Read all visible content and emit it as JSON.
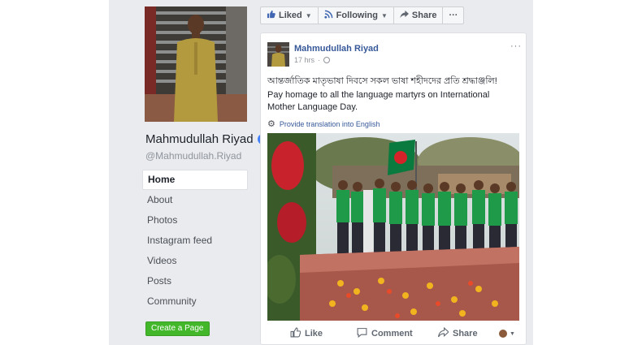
{
  "page": {
    "name": "Mahmudullah Riyad",
    "handle": "@Mahmudullah.Riyad",
    "verified_mark": "✓"
  },
  "nav": {
    "items": [
      {
        "label": "Home",
        "active": true
      },
      {
        "label": "About"
      },
      {
        "label": "Photos"
      },
      {
        "label": "Instagram feed"
      },
      {
        "label": "Videos"
      },
      {
        "label": "Posts"
      },
      {
        "label": "Community"
      }
    ]
  },
  "create_page_label": "Create a Page",
  "action_bar": {
    "liked": "Liked",
    "following": "Following",
    "share": "Share",
    "more": "···"
  },
  "post": {
    "author": "Mahmudullah Riyad",
    "time": "17 hrs",
    "more": "···",
    "text_bn": "আন্তর্জাতিক মাতৃভাষা দিবসে সকল ভাষা শহীদদের প্রতি শ্রদ্ধাঞ্জলি!",
    "text_en": "Pay homage to all the language martyrs on International Mother Language Day.",
    "translate": "Provide translation into English"
  },
  "post_actions": {
    "like": "Like",
    "comment": "Comment",
    "share": "Share"
  },
  "colors": {
    "link": "#365899",
    "accent": "#4267b2",
    "create_green": "#42b72a",
    "background": "#e9ebee"
  },
  "icons": [
    "thumbs-up-icon",
    "caret-down-icon",
    "share-arrow-icon",
    "verified-badge-icon",
    "gear-icon",
    "globe-icon",
    "comment-icon"
  ]
}
